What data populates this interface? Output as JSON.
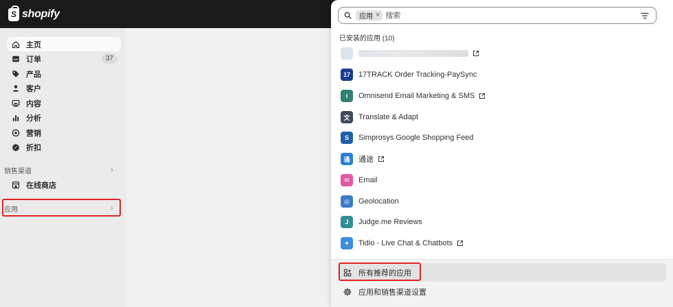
{
  "header": {
    "logo_text": "shopify"
  },
  "sidebar": {
    "items": [
      {
        "label": "主页",
        "icon": "home-icon"
      },
      {
        "label": "订单",
        "icon": "inbox-icon",
        "badge": "37"
      },
      {
        "label": "产品",
        "icon": "tag-icon"
      },
      {
        "label": "客户",
        "icon": "person-icon"
      },
      {
        "label": "内容",
        "icon": "content-icon"
      },
      {
        "label": "分析",
        "icon": "chart-icon"
      },
      {
        "label": "营销",
        "icon": "target-icon"
      },
      {
        "label": "折扣",
        "icon": "discount-icon"
      }
    ],
    "sales_channels": {
      "label": "销售渠道",
      "items": [
        {
          "label": "在线商店",
          "icon": "store-icon"
        }
      ]
    },
    "apps": {
      "label": "应用"
    }
  },
  "panel": {
    "search": {
      "chip_label": "应用",
      "placeholder": "搜索"
    },
    "installed_title": "已安装的应用 (10)",
    "apps": [
      {
        "label": "",
        "icon": "blurred-app-icon",
        "external": true
      },
      {
        "label": "17TRACK Order Tracking-PaySync",
        "icon": "17track-icon",
        "icon_text": "17",
        "color": "#1a3d8f",
        "external": false
      },
      {
        "label": "Omnisend Email Marketing & SMS",
        "icon": "omnisend-icon",
        "icon_text": "i",
        "color": "#2f7f73",
        "external": true
      },
      {
        "label": "Translate & Adapt",
        "icon": "translate-icon",
        "icon_text": "文",
        "color": "#3f4a5a",
        "external": false
      },
      {
        "label": "Simprosys Google Shopping Feed",
        "icon": "simprosys-icon",
        "icon_text": "S",
        "color": "#1f5fa8",
        "external": false
      },
      {
        "label": "通途",
        "icon": "tongtu-icon",
        "icon_text": "通",
        "color": "#2a7fd4",
        "external": true
      },
      {
        "label": "Email",
        "icon": "email-icon",
        "icon_text": "✉",
        "color": "#e05aa0",
        "external": false
      },
      {
        "label": "Geolocation",
        "icon": "geolocation-icon",
        "icon_text": "◎",
        "color": "#3b7bc8",
        "external": false
      },
      {
        "label": "Judge.me Reviews",
        "icon": "judgeme-icon",
        "icon_text": "J",
        "color": "#2f8f96",
        "external": false
      },
      {
        "label": "Tidio - Live Chat & Chatbots",
        "icon": "tidio-icon",
        "icon_text": "✦",
        "color": "#3a8fe0",
        "external": true
      }
    ],
    "footer": {
      "recommended": {
        "label": "所有推荐的应用",
        "icon": "apps-grid-icon"
      },
      "settings": {
        "label": "应用和销售渠道设置",
        "icon": "gear-icon"
      }
    }
  },
  "colors": {
    "highlight": "#e02424",
    "topbar": "#1a1a1a"
  }
}
